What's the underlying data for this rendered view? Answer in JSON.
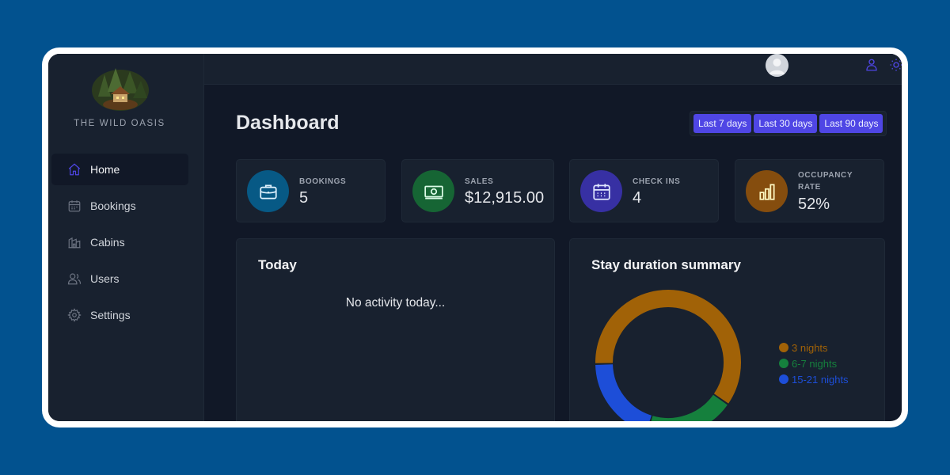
{
  "brand": {
    "name": "THE WILD OASIS"
  },
  "sidebar": {
    "items": [
      {
        "label": "Home",
        "icon": "home-icon",
        "active": true
      },
      {
        "label": "Bookings",
        "icon": "calendar-icon"
      },
      {
        "label": "Cabins",
        "icon": "cabin-icon"
      },
      {
        "label": "Users",
        "icon": "users-icon"
      },
      {
        "label": "Settings",
        "icon": "settings-icon"
      }
    ]
  },
  "header": {
    "icons": [
      "user-icon",
      "sun-icon",
      "logout-icon"
    ]
  },
  "main": {
    "title": "Dashboard",
    "filters": [
      "Last 7 days",
      "Last 30 days",
      "Last 90 days"
    ],
    "stats": [
      {
        "label": "BOOKINGS",
        "value": "5",
        "icon": "briefcase-icon",
        "color": "#075985"
      },
      {
        "label": "SALES",
        "value": "$12,915.00",
        "icon": "banknote-icon",
        "color": "#166534"
      },
      {
        "label": "CHECK INS",
        "value": "4",
        "icon": "calendar-days-icon",
        "color": "#3730a3"
      },
      {
        "label": "OCCUPANCY RATE",
        "value": "52%",
        "icon": "chart-bar-icon",
        "color": "#854d0e"
      }
    ],
    "today": {
      "title": "Today",
      "empty_text": "No activity today..."
    },
    "duration": {
      "title": "Stay duration summary",
      "segments": [
        {
          "label": "3 nights",
          "value": 3,
          "color": "#a16207"
        },
        {
          "label": "6-7 nights",
          "value": 1,
          "color": "#15803d"
        },
        {
          "label": "15-21 nights",
          "value": 1,
          "color": "#1d4ed8"
        }
      ]
    }
  },
  "colors": {
    "accent": "#4f46e5",
    "background": "#111827",
    "panel": "#18212f"
  }
}
